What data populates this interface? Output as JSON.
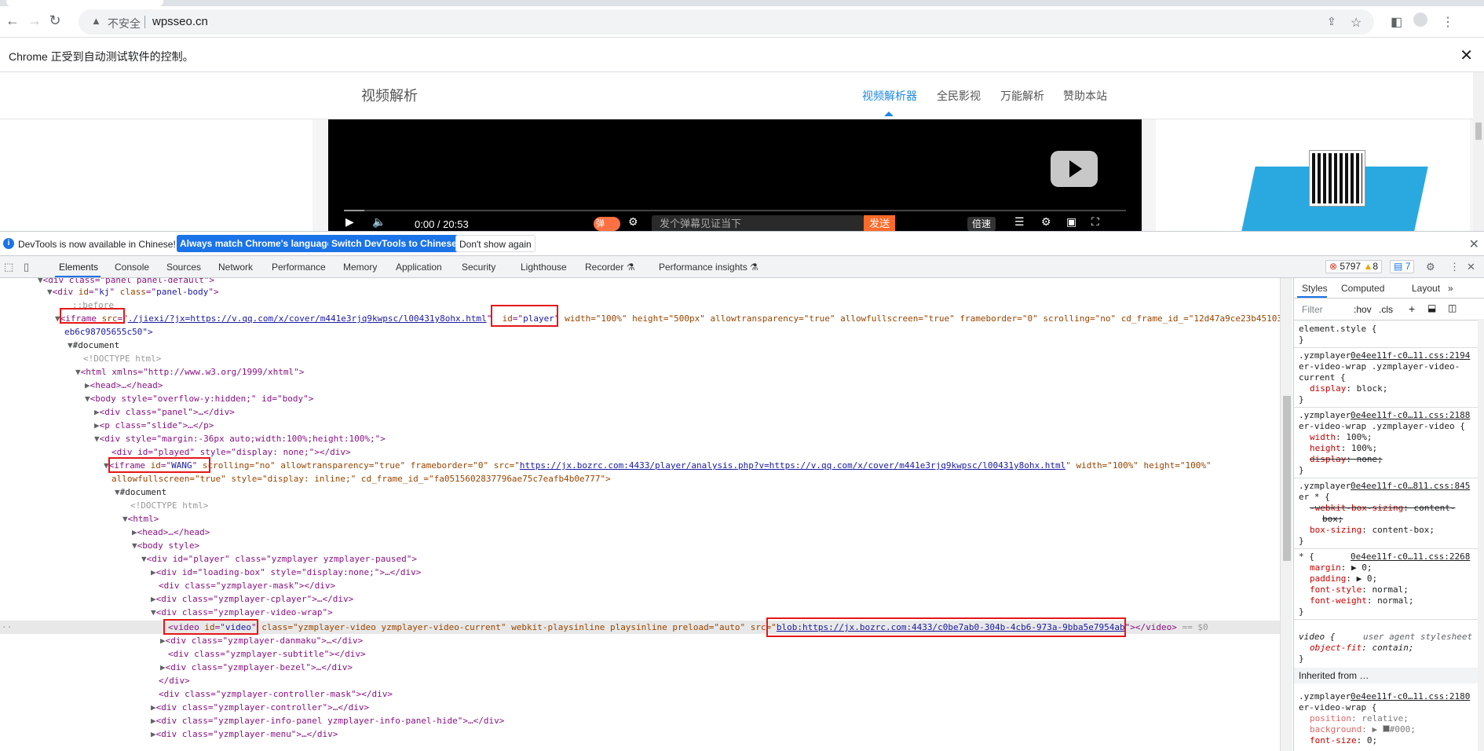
{
  "browser": {
    "security_label": "不安全",
    "url": "wpsseo.cn",
    "automation_notice": "Chrome 正受到自动测试软件的控制。"
  },
  "site": {
    "brand": "视频解析",
    "nav": [
      "视频解析器",
      "全民影视",
      "万能解析",
      "赞助本站"
    ],
    "player": {
      "time": "0:00 / 20:53",
      "danmaku_toggle": "弹",
      "danmaku_placeholder": "发个弹幕见证当下",
      "send": "发送",
      "speed": "倍速"
    }
  },
  "devtools": {
    "lang_bar": {
      "message": "DevTools is now available in Chinese!",
      "btn_match": "Always match Chrome's language",
      "btn_switch": "Switch DevTools to Chinese",
      "btn_dismiss": "Don't show again"
    },
    "tabs": [
      "Elements",
      "Console",
      "Sources",
      "Network",
      "Performance",
      "Memory",
      "Application",
      "Security",
      "Lighthouse",
      "Recorder ⚗",
      "Performance insights ⚗"
    ],
    "errors": "5797",
    "warnings": "8",
    "messages": "7",
    "dom": {
      "l0": "<div class=\"panel panel-default\">",
      "l1_tag": "div",
      "l1_attr": "id",
      "l1_val": "kj",
      "l1_attr2": "class",
      "l1_val2": "panel-body",
      "l2": "::before",
      "l3_src": "./jiexi/?jx=https://v.qq.com/x/cover/m441e3rjq9kwpsc/l00431y8ohx.html",
      "l3_id": "player",
      "l3_rest": " width=\"100%\" height=\"500px\" allowtransparency=\"true\" allowfullscreen=\"true\" frameborder=\"0\" scrolling=\"no\" cd_frame_id_=\"12d47a9ce23b45103",
      "l3_wrap": "eb6c98705655c50\">",
      "l4": "#document",
      "l5": "<!DOCTYPE html>",
      "l6": "<html xmlns=\"http://www.w3.org/1999/xhtml\">",
      "l7": "<head>…</head>",
      "l8": "<body style=\"overflow-y:hidden;\" id=\"body\">",
      "l9": "<div class=\"panel\">…</div>",
      "l10": "<p class=\"slide\">…</p>",
      "l11": "<div style=\"margin:-36px auto;width:100%;height:100%;\">",
      "l12": "<div id=\"played\" style=\"display: none;\"></div>",
      "l13_id": "WANG",
      "l13_rest": " scrolling=\"no\" allowtransparency=\"true\" frameborder=\"0\" src=\"",
      "l13_src": "https://jx.bozrc.com:4433/player/analysis.php?v=https://v.qq.com/x/cover/m441e3rjq9kwpsc/l00431y8ohx.html",
      "l13_tail": "\" width=\"100%\" height=\"100%\"",
      "l13_wrap": "allowfullscreen=\"true\" style=\"display: inline;\" cd_frame_id_=\"fa0515602837796ae75c7eafb4b0e777\">",
      "l14": "#document",
      "l15": "<!DOCTYPE html>",
      "l16": "<html>",
      "l17": "<head>…</head>",
      "l18": "<body style>",
      "l19": "<div id=\"player\" class=\"yzmplayer yzmplayer-paused\">",
      "l20": "<div id=\"loading-box\" style=\"display:none;\">…</div>",
      "l21": "<div class=\"yzmplayer-mask\"></div>",
      "l22": "<div class=\"yzmplayer-cplayer\">…</div>",
      "l23": "<div class=\"yzmplayer-video-wrap\">",
      "l24_id": "video",
      "l24_rest": " class=\"yzmplayer-video yzmplayer-video-current\" webkit-playsinline playsinline preload=\"auto\" src=\"",
      "l24_src": "blob:https://jx.bozrc.com:4433/c0be7ab0-304b-4cb6-973a-9bba5e7954ab",
      "l24_tail": "\"></video>",
      "l24_eq": " == $0",
      "l25": "<div class=\"yzmplayer-danmaku\">…</div>",
      "l26": "<div class=\"yzmplayer-subtitle\"></div>",
      "l27": "<div class=\"yzmplayer-bezel\">…</div>",
      "l28": "</div>",
      "l29": "<div class=\"yzmplayer-controller-mask\"></div>",
      "l30": "<div class=\"yzmplayer-controller\">…</div>",
      "l31": "<div class=\"yzmplayer-info-panel yzmplayer-info-panel-hide\">…</div>",
      "l32": "<div class=\"yzmplayer-menu\">…</div>"
    },
    "styles": {
      "tabs": [
        "Styles",
        "Computed",
        "Layout",
        "»"
      ],
      "filter_placeholder": "Filter",
      "hov": ":hov",
      "cls": ".cls",
      "element_style": "element.style {",
      "r1_sel1": ".yzmplayer",
      "r1_src": "0e4ee11f-c0…11.css:2194",
      "r1_sel2": "er-video-wrap .yzmplayer-video-",
      "r1_sel3": "current {",
      "r1_p1": "display",
      "r1_v1": "block;",
      "r2_sel1": ".yzmplayer",
      "r2_src": "0e4ee11f-c0…11.css:2188",
      "r2_sel2": "er-video-wrap .yzmplayer-video {",
      "r2_p1": "width",
      "r2_v1": "100%;",
      "r2_p2": "height",
      "r2_v2": "100%;",
      "r2_p3": "display",
      "r2_v3": "none;",
      "r3_sel1": ".yzmplayer",
      "r3_src": "0e4ee11f-c0…811.css:845",
      "r3_sel2": "er * {",
      "r3_p1": "-webkit-box-sizing",
      "r3_v1": "content-",
      "r3_v1b": "box;",
      "r3_p2": "box-sizing",
      "r3_v2": "content-box;",
      "r4_sel1": "* {",
      "r4_src": "0e4ee11f-c0…11.css:2268",
      "r4_p1": "margin",
      "r4_v1": "0;",
      "r4_p2": "padding",
      "r4_v2": "0;",
      "r4_p3": "font-style",
      "r4_v3": "normal;",
      "r4_p4": "font-weight",
      "r4_v4": "normal;",
      "r5_sel1": "video {",
      "r5_src": "user agent stylesheet",
      "r5_p1": "object-fit",
      "r5_v1": "contain;",
      "inherited": "Inherited from …",
      "r6_sel1": ".yzmplayer",
      "r6_src": "0e4ee11f-c0…11.css:2180",
      "r6_sel2": "er-video-wrap {",
      "r6_p1": "position",
      "r6_v1": "relative;",
      "r6_p2": "background",
      "r6_v2": "#000;",
      "r6_p3": "font-size",
      "r6_v3": "0;"
    }
  }
}
